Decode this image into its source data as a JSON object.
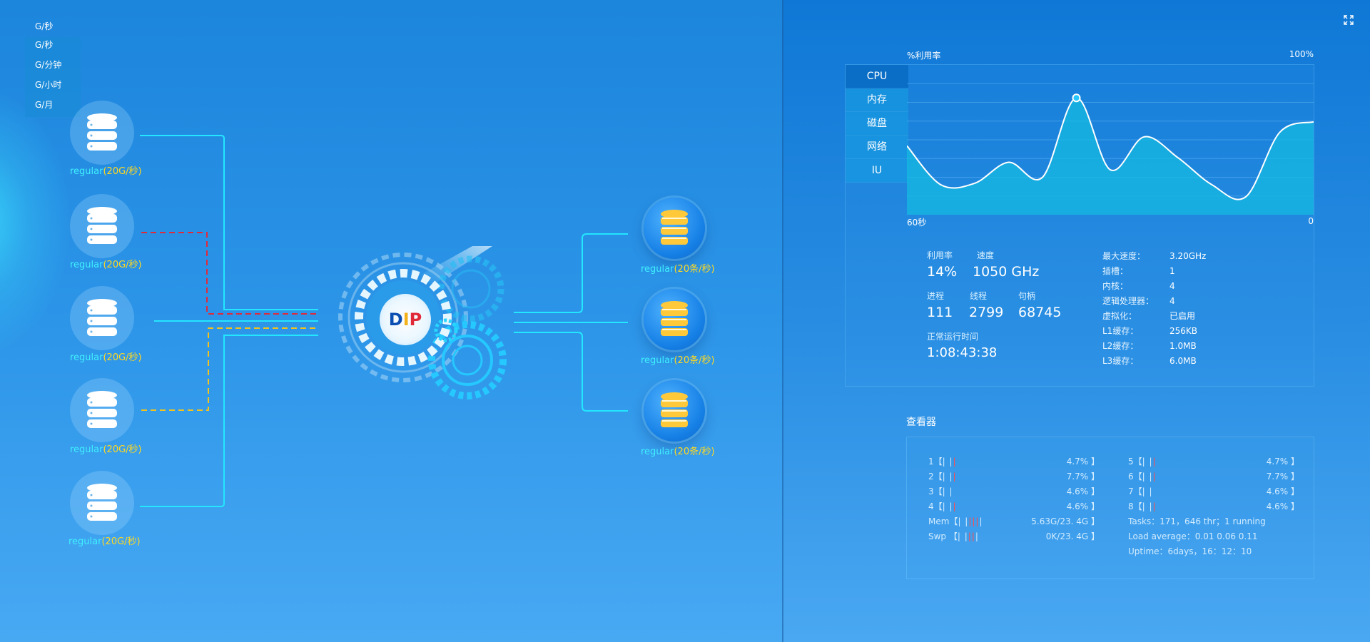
{
  "units": {
    "current": "G/秒",
    "options": [
      "G/秒",
      "G/分钟",
      "G/小时",
      "G/月"
    ]
  },
  "sources": [
    {
      "name": "regular",
      "rate": "(20G/秒)"
    },
    {
      "name": "regular",
      "rate": "(20G/秒)"
    },
    {
      "name": "regular",
      "rate": "(20G/秒)"
    },
    {
      "name": "regular",
      "rate": "(20G/秒)"
    },
    {
      "name": "regular",
      "rate": "(20G/秒)"
    }
  ],
  "targets": [
    {
      "name": "regular",
      "rate": "(20条/秒)"
    },
    {
      "name": "regular",
      "rate": "(20条/秒)"
    },
    {
      "name": "regular",
      "rate": "(20条/秒)"
    }
  ],
  "logo": {
    "d": "D",
    "i": "I",
    "p": "P"
  },
  "colors": {
    "cyan": "#3ff0ff",
    "yellow": "#ffd820",
    "red_dash": "#e02a3a",
    "yellow_dash": "#f3c21b"
  },
  "monitor": {
    "tabs": [
      "CPU",
      "内存",
      "磁盘",
      "网络",
      "IU"
    ],
    "chart_title_left": "%利用率",
    "chart_title_right": "100%",
    "axis_left": "60秒",
    "axis_right": "0",
    "chart_data": {
      "type": "area",
      "x": [
        60,
        55,
        50,
        45,
        40,
        35,
        30,
        25,
        20,
        15,
        10,
        5,
        0
      ],
      "y": [
        46,
        20,
        21,
        35,
        25,
        78,
        30,
        52,
        38,
        20,
        12,
        55,
        62
      ],
      "ylim": [
        0,
        100
      ]
    },
    "stats": {
      "labels1": [
        "利用率",
        "速度"
      ],
      "vals1": [
        "14%",
        "1050 GHz"
      ],
      "labels2": [
        "进程",
        "线程",
        "句柄"
      ],
      "vals2": [
        "111",
        "2799",
        "68745"
      ],
      "uptime_label": "正常运行时间",
      "uptime": "1:08:43:38"
    },
    "specs": [
      {
        "k": "最大速度：",
        "v": "3.20GHz"
      },
      {
        "k": "插槽：",
        "v": "1"
      },
      {
        "k": "内核：",
        "v": "4"
      },
      {
        "k": "逻辑处理器：",
        "v": "4"
      },
      {
        "k": "虚拟化：",
        "v": "已启用"
      },
      {
        "k": "L1缓存：",
        "v": "256KB"
      },
      {
        "k": "L2缓存：",
        "v": "1.0MB"
      },
      {
        "k": "L3缓存：",
        "v": "6.0MB"
      }
    ]
  },
  "viewer": {
    "title": "查看器",
    "cpus_left": [
      {
        "id": "1【",
        "bars": "| |",
        "red": "|",
        "pct": "4.7% 】"
      },
      {
        "id": "2【",
        "bars": "| |",
        "red": "|",
        "pct": "7.7% 】"
      },
      {
        "id": "3【",
        "bars": "| |",
        "red": "",
        "pct": "4.6% 】"
      },
      {
        "id": "4【",
        "bars": "| |",
        "red": "|",
        "pct": "4.6% 】"
      }
    ],
    "cpus_right": [
      {
        "id": "5【",
        "bars": "| |",
        "red": "|",
        "pct": "4.7% 】"
      },
      {
        "id": "6【",
        "bars": "| |",
        "red": "|",
        "pct": "7.7% 】"
      },
      {
        "id": "7【",
        "bars": "| |",
        "red": "",
        "pct": "4.6% 】"
      },
      {
        "id": "8【",
        "bars": "| |",
        "red": "|",
        "pct": "4.6% 】"
      }
    ],
    "mem": {
      "label": "Mem【",
      "bars1": "| |",
      "red": "|||",
      "bars2": "|",
      "val": "5.63G/23. 4G 】"
    },
    "swp": {
      "label": "Swp 【",
      "bars1": "| |",
      "red": "||",
      "bars2": "|",
      "val": "0K/23. 4G 】"
    },
    "tasks": "Tasks：171，646 thr；1 running",
    "load": "Load average：0.01    0.06   0.11",
    "uptime": "Uptime：6days，16：12：10"
  }
}
